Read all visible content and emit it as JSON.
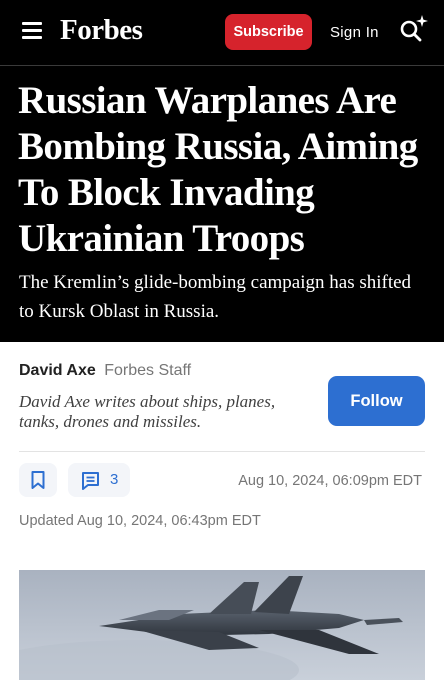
{
  "header": {
    "logo": "Forbes",
    "subscribe_label": "Subscribe",
    "signin_label": "Sign In",
    "icons": [
      "menu-icon",
      "search-sparkle-icon"
    ],
    "colors": {
      "background": "#000000",
      "subscribe": "#d6232c"
    }
  },
  "article": {
    "headline": "Russian Warplanes Are Bombing Russia, Aiming To Block Invading Ukrainian Troops",
    "dek": "The Kremlin’s glide-bombing campaign has shifted to Kursk Oblast in Russia."
  },
  "author": {
    "name": "David Axe",
    "role": "Forbes Staff",
    "bio": "David Axe writes about ships, planes, tanks, drones and missiles.",
    "follow_label": "Follow",
    "colors": {
      "follow": "#2d6fd1"
    }
  },
  "meta": {
    "comment_count": "3",
    "published": "Aug 10, 2024, 06:09pm EDT",
    "updated": "Updated Aug 10, 2024, 06:43pm EDT",
    "icons": [
      "bookmark-icon",
      "comment-icon"
    ]
  }
}
